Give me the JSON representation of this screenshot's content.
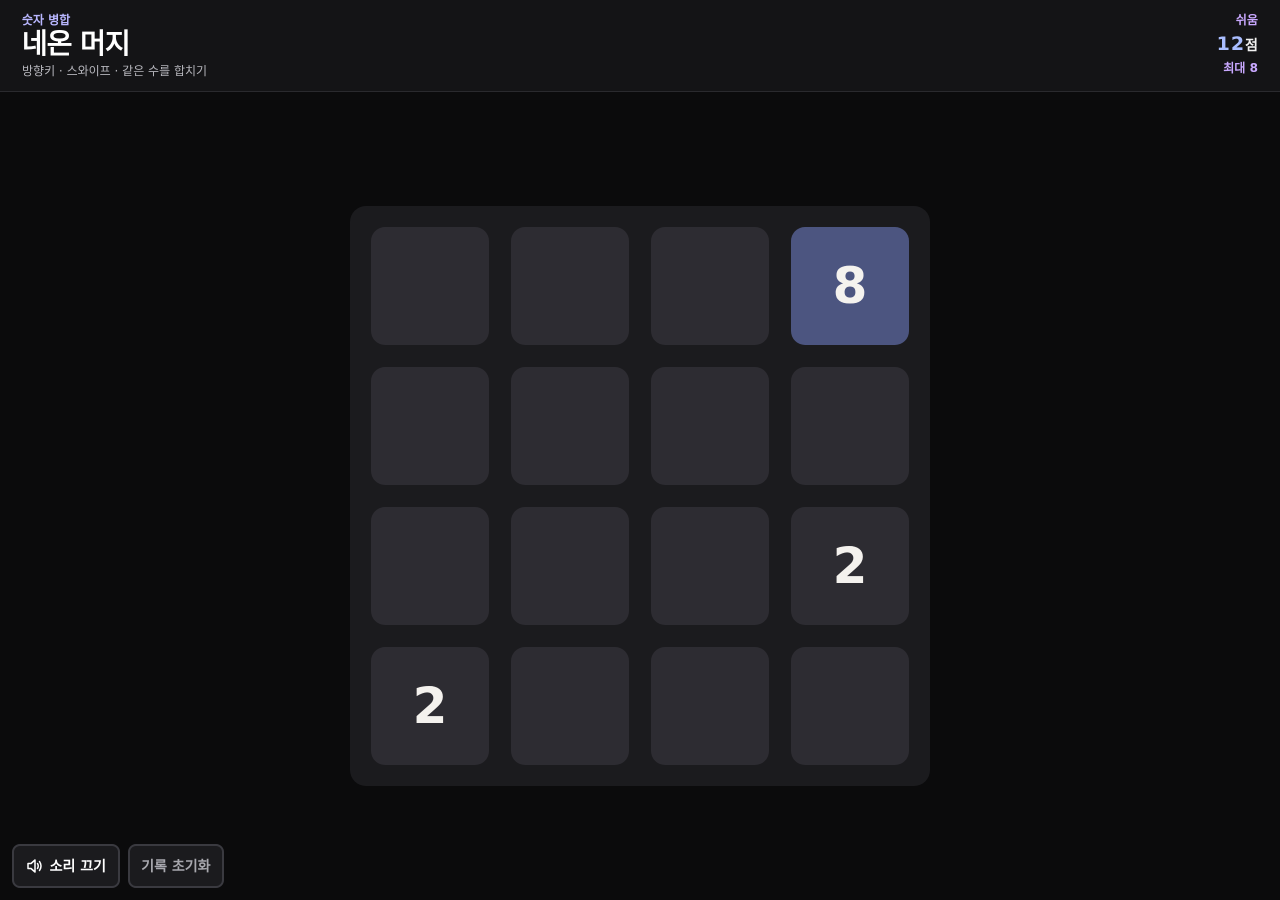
{
  "header": {
    "category": "숫자 병합",
    "title": "네온 머지",
    "hint": "방향키 · 스와이프 · 같은 수를 합치기",
    "difficulty": "쉬움",
    "score": "12",
    "score_unit": "점",
    "best": "최대 8"
  },
  "board": {
    "rows": [
      [
        "",
        "",
        "",
        "8"
      ],
      [
        "",
        "",
        "",
        ""
      ],
      [
        "",
        "",
        "",
        "2"
      ],
      [
        "2",
        "",
        "",
        ""
      ]
    ]
  },
  "footer": {
    "sound_label": "소리 끄기",
    "sound_icon": "speaker-icon",
    "reset_label": "기록 초기화"
  },
  "colors": {
    "background": "#0b0b0c",
    "board": "#1b1b1e",
    "empty_tile": "#2d2c32",
    "tile_8": "#4c5580",
    "accent_purple": "#c9a8ff",
    "accent_blue": "#a9bdff"
  }
}
